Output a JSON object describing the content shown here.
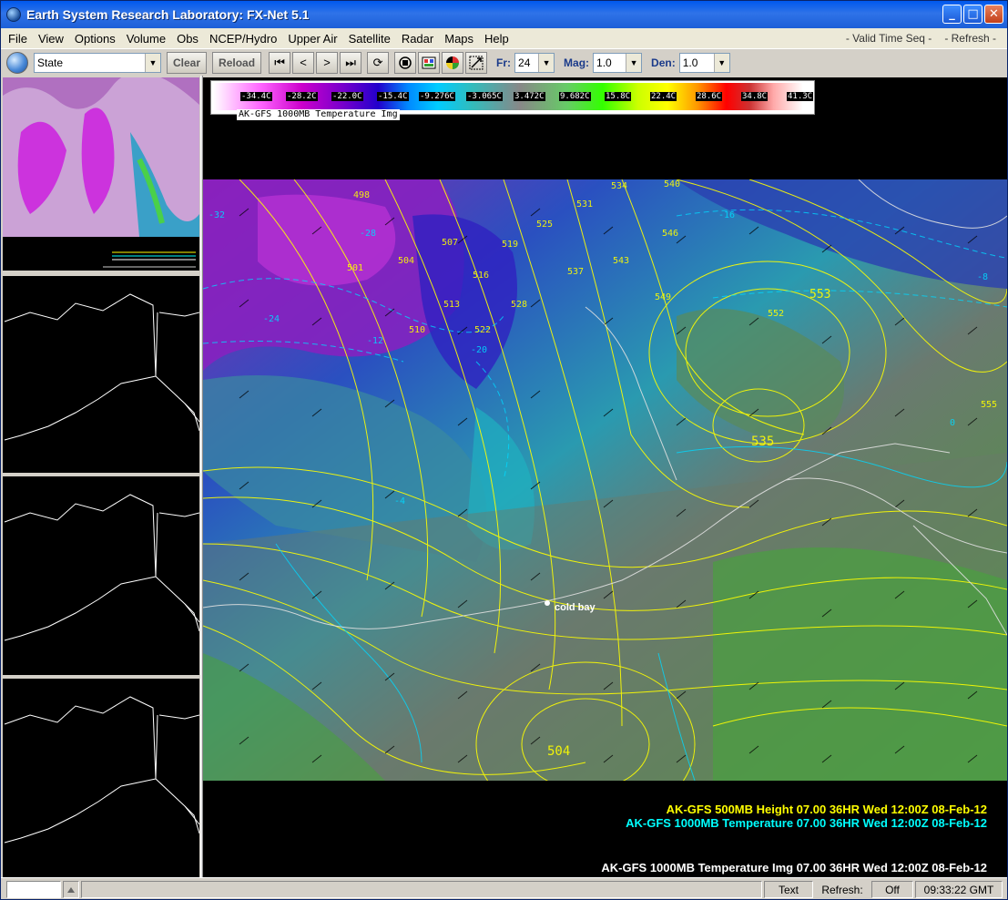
{
  "window": {
    "title": "Earth System Research Laboratory: FX-Net 5.1",
    "buttons": {
      "minimize": "_",
      "maximize": "□",
      "close": "✕"
    }
  },
  "menubar": {
    "items": [
      "File",
      "View",
      "Options",
      "Volume",
      "Obs",
      "NCEP/Hydro",
      "Upper Air",
      "Satellite",
      "Radar",
      "Maps",
      "Help"
    ],
    "right": [
      "- Valid Time Seq -",
      "- Refresh -"
    ]
  },
  "toolbar": {
    "scope_value": "State",
    "clear_label": "Clear",
    "reload_label": "Reload",
    "first_icon": "⏮",
    "prev_icon": "<",
    "next_icon": ">",
    "last_icon": "⏭",
    "loop_icon": "⟳",
    "fr_label": "Fr:",
    "fr_value": "24",
    "mag_label": "Mag:",
    "mag_value": "1.0",
    "den_label": "Den:",
    "den_value": "1.0"
  },
  "colorbar": {
    "labels": [
      "-34.4C",
      "-28.2C",
      "-22.0C",
      "-15.4C",
      "-9.276C",
      "-3.065C",
      "3.472C",
      "9.682C",
      "15.8C",
      "22.4C",
      "28.6C",
      "34.8C",
      "41.3C"
    ],
    "title": "AK-GFS 1000MB Temperature Img"
  },
  "map": {
    "city": "cold bay",
    "height_contours": [
      "498",
      "501",
      "504",
      "507",
      "510",
      "513",
      "516",
      "519",
      "522",
      "525",
      "528",
      "531",
      "534",
      "537",
      "540",
      "543",
      "546",
      "549",
      "552",
      "553",
      "555",
      "535",
      "504"
    ],
    "temp_contours": [
      "-32",
      "-28",
      "-24",
      "-20",
      "-16",
      "-12",
      "-8",
      "-4",
      "0"
    ]
  },
  "legend": [
    {
      "text": "AK-GFS 500MB Height  07.00   36HR Wed 12:00Z 08-Feb-12",
      "color": "#ffff00"
    },
    {
      "text": "AK-GFS 1000MB Temperature  07.00   36HR Wed 12:00Z 08-Feb-12",
      "color": "#00ffff"
    },
    {
      "text": "AK-GFS 1000MB Temperature Img 07.00   36HR Wed 12:00Z 08-Feb-12",
      "color": "#ffffff"
    }
  ],
  "statusbar": {
    "text_label": "Text",
    "refresh_label": "Refresh:",
    "refresh_value": "Off",
    "clock": "09:33:22 GMT"
  },
  "colors": {
    "height_contour": "#ffff00",
    "temp_contour": "#00ffff",
    "background": "#000000",
    "titlebar": "#0058ee"
  }
}
